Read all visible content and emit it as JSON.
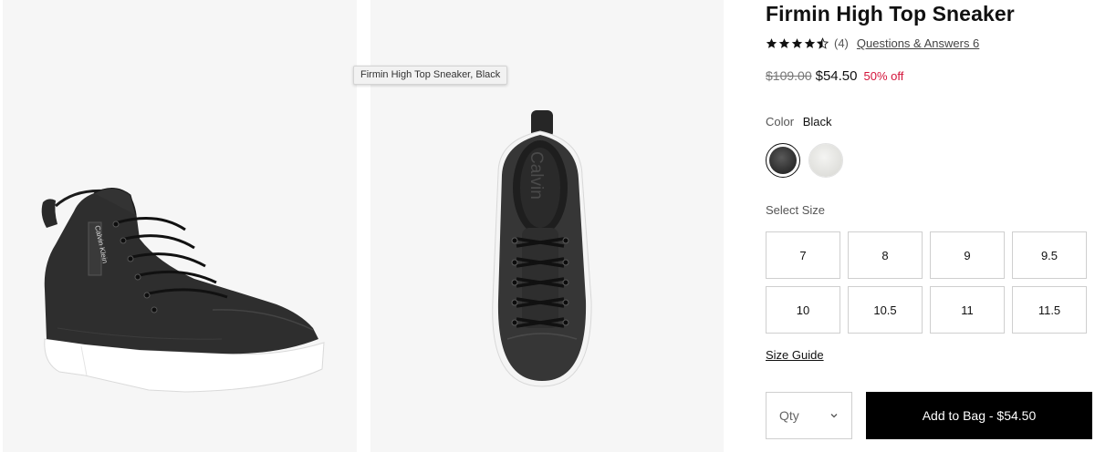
{
  "product": {
    "title": "Firmin High Top Sneaker",
    "rating": 4.5,
    "review_count": "(4)",
    "qa_link": "Questions & Answers 6",
    "original_price": "$109.00",
    "sale_price": "$54.50",
    "discount": "50% off"
  },
  "images": {
    "tooltip": "Firmin High Top Sneaker, Black",
    "brand_text_side": "Calvin Klein",
    "brand_text_top": "Calvin"
  },
  "color": {
    "label": "Color",
    "selected": "Black",
    "swatches": [
      "black",
      "white"
    ]
  },
  "size": {
    "label": "Select Size",
    "options": [
      "7",
      "8",
      "9",
      "9.5",
      "10",
      "10.5",
      "11",
      "11.5"
    ],
    "guide": "Size Guide"
  },
  "purchase": {
    "qty_label": "Qty",
    "add_to_bag": "Add to Bag - $54.50"
  },
  "colors": {
    "sale_red": "#d3143a",
    "button_black": "#000000"
  }
}
